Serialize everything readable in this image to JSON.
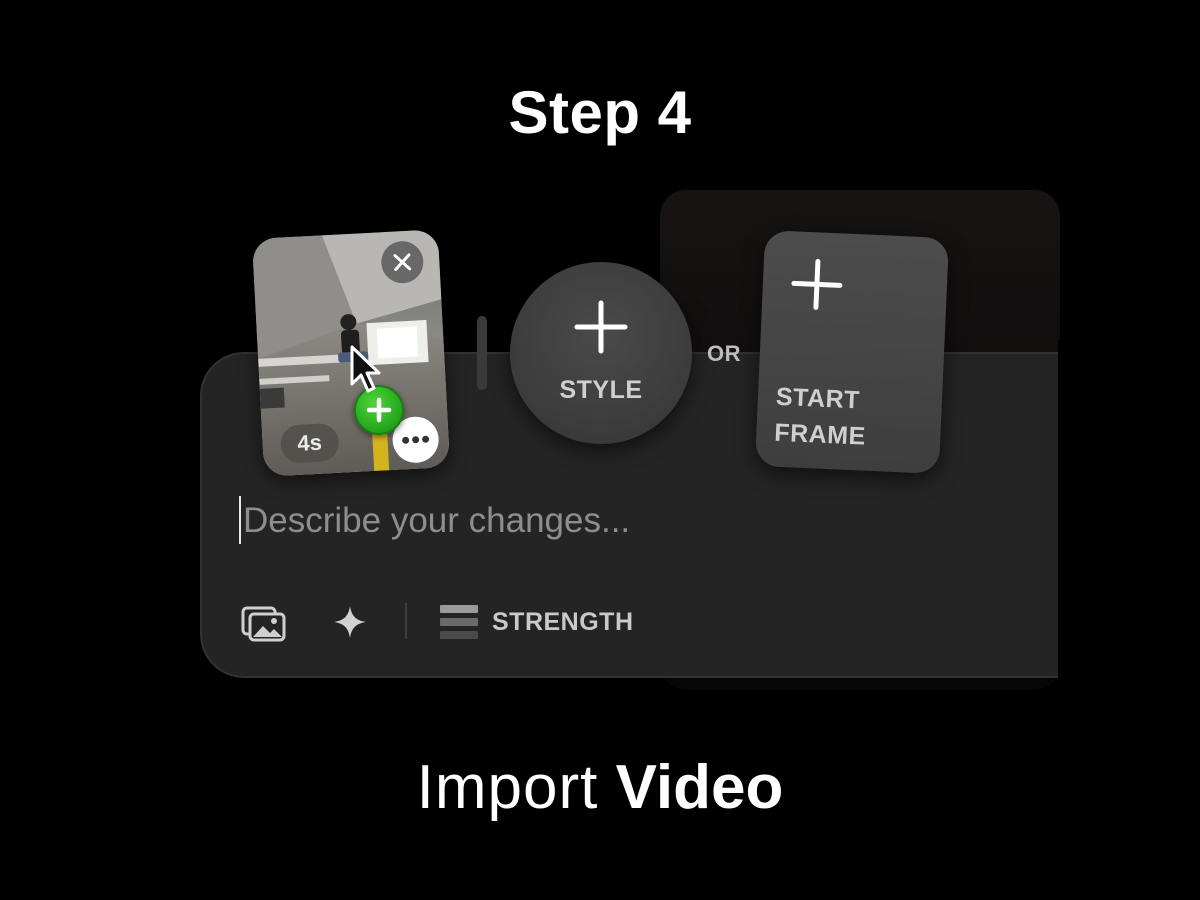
{
  "step_title": "Step 4",
  "composer": {
    "input_placeholder": "Describe your changes...",
    "input_value": ""
  },
  "toolbar": {
    "gallery_icon": "image-gallery-icon",
    "sparkle_icon": "sparkle-icon",
    "strength_icon": "strength-bars-icon",
    "strength_label": "STRENGTH"
  },
  "video_card": {
    "duration": "4s",
    "close_icon": "close-icon",
    "more_icon": "more-options-icon",
    "add_icon": "add-plus-icon"
  },
  "style_button": {
    "label": "STYLE",
    "icon": "plus-icon"
  },
  "or_label": "OR",
  "start_frame_button": {
    "label_line1": "START",
    "label_line2": "FRAME",
    "icon": "plus-icon"
  },
  "caption": {
    "light": "Import",
    "bold": "Video"
  },
  "colors": {
    "background": "#000000",
    "composer": "#242424",
    "accent_green": "#22a51c",
    "muted_text": "#8e8e8e"
  }
}
